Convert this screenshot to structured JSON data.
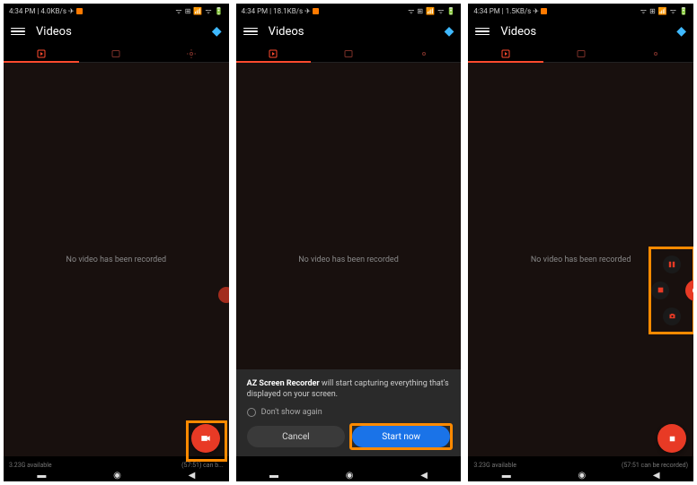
{
  "status": {
    "time": "4:34 PM",
    "speeds": [
      "4.0KB/s",
      "18.1KB/s",
      "1.5KB/s"
    ]
  },
  "header": {
    "title": "Videos"
  },
  "empty_message": "No video has been recorded",
  "bottom": {
    "storage": "3.23G available",
    "time_msg1": "(57:51) can b...",
    "time_msg2": "(57:51 can be recorded)"
  },
  "dialog": {
    "app_name": "AZ Screen Recorder",
    "text_rest": " will start capturing everything that's displayed on your screen.",
    "dont_show": "Don't show again",
    "cancel": "Cancel",
    "start": "Start now"
  },
  "icons": {
    "menu": "menu",
    "diamond": "diamond",
    "play": "play-box",
    "image": "image",
    "gear": "gear",
    "camcorder": "camcorder",
    "stop": "stop",
    "pause": "pause",
    "rec": "rec",
    "camera": "camera"
  }
}
